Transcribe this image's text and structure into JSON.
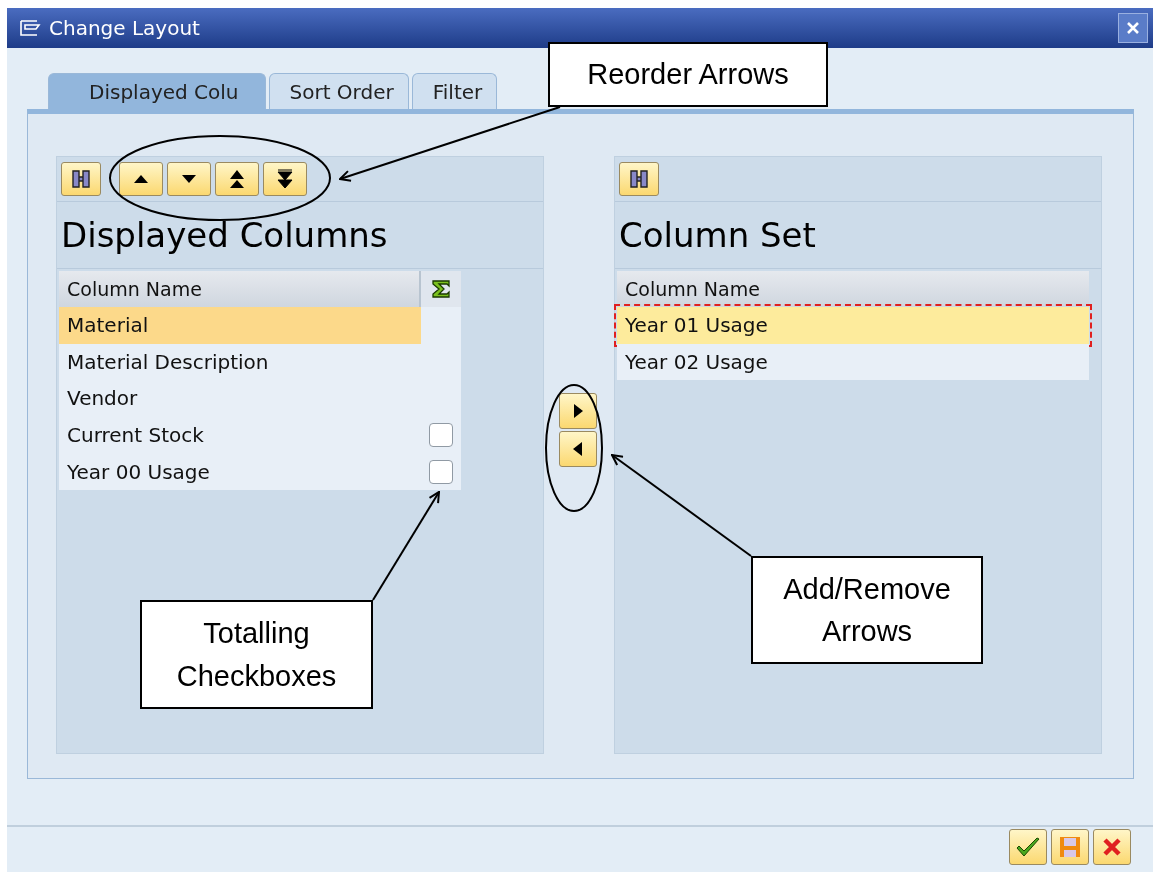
{
  "window": {
    "title": "Change Layout"
  },
  "tabs": [
    {
      "label": "Displayed Colu",
      "selected": true
    },
    {
      "label": "Sort Order",
      "selected": false
    },
    {
      "label": "Filter",
      "selected": false
    }
  ],
  "displayed_columns": {
    "title": "Displayed Columns",
    "column_header": "Column Name",
    "rows": [
      {
        "label": "Material",
        "selected": true
      },
      {
        "label": "Material Description",
        "selected": false
      },
      {
        "label": "Vendor",
        "selected": false
      },
      {
        "label": "Current Stock",
        "selected": false,
        "totals": {
          "checked": false
        }
      },
      {
        "label": "Year 00 Usage",
        "selected": false,
        "totals": {
          "checked": false
        }
      }
    ]
  },
  "column_set": {
    "title": "Column Set",
    "column_header": "Column Name",
    "rows": [
      {
        "label": "Year 01 Usage",
        "selected": true
      },
      {
        "label": "Year 02 Usage",
        "selected": false
      }
    ]
  },
  "annotations": [
    {
      "text": "Reorder Arrows"
    },
    {
      "text": "Totalling Checkboxes"
    },
    {
      "text": "Add/Remove Arrows"
    }
  ]
}
